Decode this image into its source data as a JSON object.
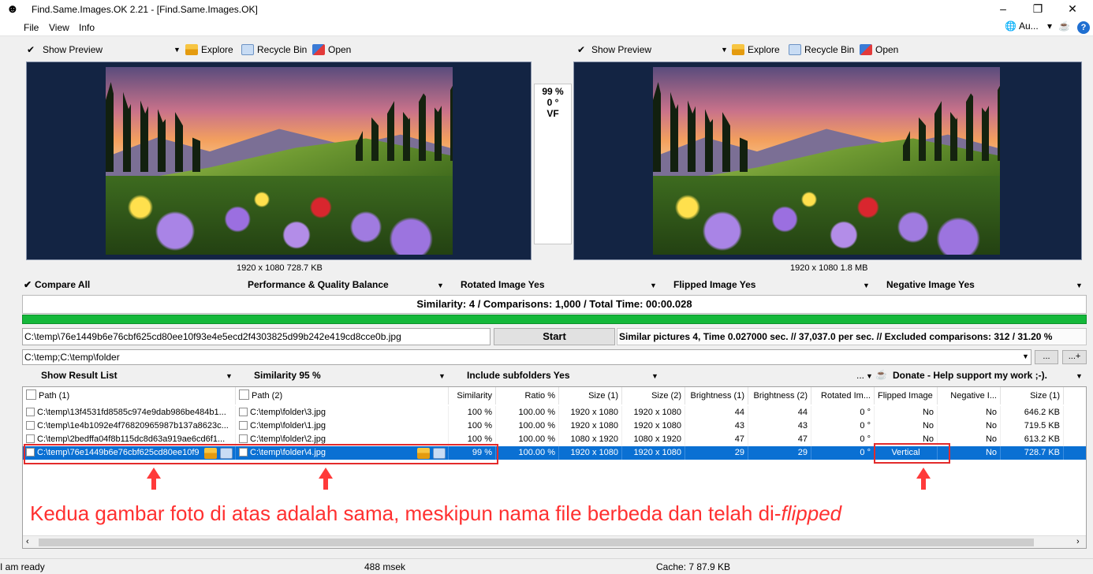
{
  "window": {
    "title": "Find.Same.Images.OK 2.21 - [Find.Same.Images.OK]",
    "minimize": "–",
    "maximize": "❐",
    "close": "✕"
  },
  "menu": {
    "file": "File",
    "view": "View",
    "info": "Info",
    "lang": "Au...",
    "lang_arrow": "▾",
    "help": "?"
  },
  "left_toolbar": {
    "show_preview": "Show Preview",
    "explore": "Explore",
    "recycle": "Recycle Bin",
    "open": "Open"
  },
  "right_toolbar": {
    "show_preview": "Show Preview",
    "explore": "Explore",
    "recycle": "Recycle Bin",
    "open": "Open"
  },
  "left_image": {
    "dims": "1920 x 1080 728.7 KB"
  },
  "right_image": {
    "dims": "1920 x 1080 1.8 MB"
  },
  "center_info": {
    "similarity": "99 %",
    "rotation": "0 °",
    "flip": "VF"
  },
  "options": {
    "compare_all": "Compare All",
    "performance": "Performance & Quality Balance",
    "rotated": "Rotated Image Yes",
    "flipped": "Flipped Image Yes",
    "negative": "Negative Image Yes"
  },
  "summary": "Similarity: 4 / Comparisons: 1,000 / Total Time: 00:00.028",
  "progress": 1.0,
  "current_file": "C:\\temp\\76e1449b6e76cbf625cd80ee10f93e4e5ecd2f4303825d99b242e419cd8cce0b.jpg",
  "start_label": "Start",
  "status_info": "Similar pictures 4, Time 0.027000 sec. // 37,037.0 per sec. // Excluded comparisons: 312 / 31.20 %",
  "folders": {
    "value": "C:\\temp;C:\\temp\\folder",
    "browse": "...",
    "add": "...+"
  },
  "result_options": {
    "show_list": "Show Result List",
    "similarity": "Similarity 95 %",
    "subfolders": "Include subfolders Yes",
    "more": "...",
    "donate": "Donate - Help support my work ;-)."
  },
  "columns": [
    "Path (1)",
    "Path (2)",
    "Similarity",
    "Ratio %",
    "Size (1)",
    "Size (2)",
    "Brightness (1)",
    "Brightness (2)",
    "Rotated Im...",
    "Flipped Image",
    "Negative I...",
    "Size (1)"
  ],
  "rows": [
    {
      "path1": "C:\\temp\\13f4531fd8585c974e9dab986be484b1...",
      "path2": "C:\\temp\\folder\\3.jpg",
      "sim": "100 %",
      "ratio": "100.00 %",
      "size1": "1920 x 1080",
      "size2": "1920 x 1080",
      "b1": "44",
      "b2": "44",
      "rot": "0 °",
      "flip": "No",
      "neg": "No",
      "fsize": "646.2 KB"
    },
    {
      "path1": "C:\\temp\\1e4b1092e4f76820965987b137a8623c...",
      "path2": "C:\\temp\\folder\\1.jpg",
      "sim": "100 %",
      "ratio": "100.00 %",
      "size1": "1920 x 1080",
      "size2": "1920 x 1080",
      "b1": "43",
      "b2": "43",
      "rot": "0 °",
      "flip": "No",
      "neg": "No",
      "fsize": "719.5 KB"
    },
    {
      "path1": "C:\\temp\\2bedffa04f8b115dc8d63a919ae6cd6f1...",
      "path2": "C:\\temp\\folder\\2.jpg",
      "sim": "100 %",
      "ratio": "100.00 %",
      "size1": "1080 x 1920",
      "size2": "1080 x 1920",
      "b1": "47",
      "b2": "47",
      "rot": "0 °",
      "flip": "No",
      "neg": "No",
      "fsize": "613.2 KB"
    },
    {
      "path1": "C:\\temp\\76e1449b6e76cbf625cd80ee10f9",
      "path2": "C:\\temp\\folder\\4.jpg",
      "sim": "99 %",
      "ratio": "100.00 %",
      "size1": "1920 x 1080",
      "size2": "1920 x 1080",
      "b1": "29",
      "b2": "29",
      "rot": "0 °",
      "flip": "Vertical",
      "neg": "No",
      "fsize": "728.7 KB"
    }
  ],
  "caption": {
    "main": "Kedua gambar foto di atas adalah sama, meskipun nama file berbeda dan telah di-",
    "italic": "flipped"
  },
  "statusbar": {
    "ready": "I am ready",
    "msek": "488 msek",
    "cache": "Cache: 7 87.9 KB"
  },
  "colors": {
    "selection": "#0a70d3",
    "progress": "#14b83a",
    "annotation": "#ff3030",
    "preview_bg": "#132443"
  }
}
